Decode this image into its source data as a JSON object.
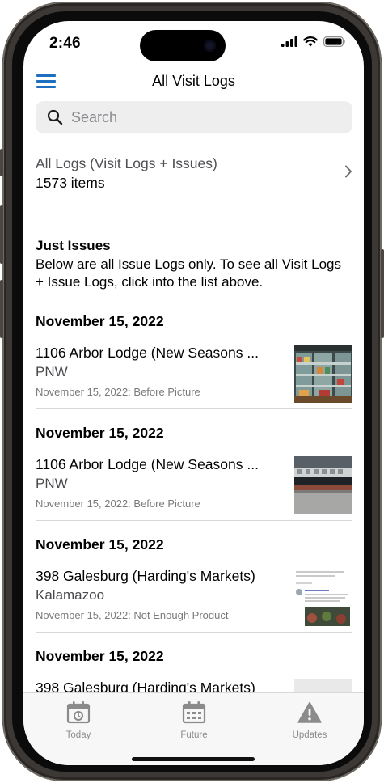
{
  "status_bar": {
    "time": "2:46"
  },
  "nav": {
    "title": "All Visit Logs",
    "menu_icon": "hamburger-icon"
  },
  "search": {
    "placeholder": "Search"
  },
  "all_logs": {
    "title": "All Logs (Visit Logs + Issues)",
    "count": "1573 items"
  },
  "issues_section": {
    "heading": "Just Issues",
    "description": "Below are all Issue Logs only. To see all Visit Logs + Issue Logs, click into the list above."
  },
  "logs": [
    {
      "date": "November 15, 2022",
      "title": "1106 Arbor Lodge (New Seasons ...",
      "region": "PNW",
      "note": "November 15, 2022: Before Picture"
    },
    {
      "date": "November 15, 2022",
      "title": "1106 Arbor Lodge (New Seasons ...",
      "region": "PNW",
      "note": "November 15, 2022: Before Picture"
    },
    {
      "date": "November 15, 2022",
      "title": "398 Galesburg (Harding's Markets)",
      "region": "Kalamazoo",
      "note": "November 15, 2022: Not Enough Product"
    },
    {
      "date": "November 15, 2022",
      "title": "398 Galesburg (Harding's Markets)",
      "region": "",
      "note": ""
    }
  ],
  "tabs": [
    {
      "label": "Today",
      "icon": "calendar-today-icon"
    },
    {
      "label": "Future",
      "icon": "calendar-grid-icon"
    },
    {
      "label": "Updates",
      "icon": "warning-icon"
    }
  ],
  "colors": {
    "accent": "#1e6fbf",
    "tab_gray": "#8b8b8b"
  }
}
